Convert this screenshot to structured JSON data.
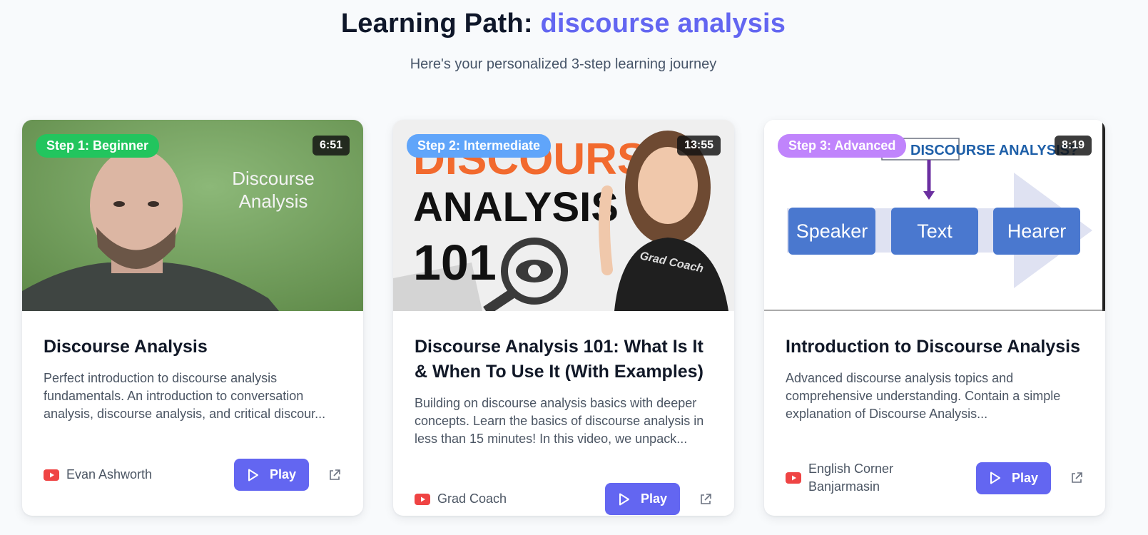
{
  "header": {
    "title_prefix": "Learning Path:",
    "topic": "discourse analysis",
    "subtitle": "Here's your personalized 3-step learning journey"
  },
  "colors": {
    "accent": "#6366f1",
    "step1": "#22c55e",
    "step2": "#60a5fa",
    "step3": "#c084fc",
    "youtube": "#ef4444"
  },
  "cards": [
    {
      "badge": "Step 1: Beginner",
      "duration": "6:51",
      "thumb_text": [
        "Discourse",
        "Analysis"
      ],
      "title": "Discourse Analysis",
      "description": "Perfect introduction to discourse analysis fundamentals. An introduction to conversation analysis, discourse analysis, and critical discour...",
      "channel": "Evan Ashworth",
      "play_label": "Play"
    },
    {
      "badge": "Step 2: Intermediate",
      "duration": "13:55",
      "thumb_text": [
        "DISCOURSE",
        "ANALYSIS",
        "101",
        "Grad Coach"
      ],
      "title": "Discourse Analysis 101: What Is It & When To Use It (With Examples)",
      "description": "Building on discourse analysis basics with deeper concepts. Learn the basics of discourse analysis in less than 15 minutes! In this video, we unpack...",
      "channel": "Grad Coach",
      "play_label": "Play"
    },
    {
      "badge": "Step 3: Advanced",
      "duration": "8:19",
      "thumb_text": [
        "DISCOURSE ANALYSIS?",
        "Speaker",
        "Text",
        "Hearer"
      ],
      "title": "Introduction to Discourse Analysis",
      "description": "Advanced discourse analysis topics and comprehensive understanding. Contain a simple explanation of Discourse Analysis...",
      "channel": "English Corner Banjarmasin",
      "play_label": "Play"
    }
  ]
}
